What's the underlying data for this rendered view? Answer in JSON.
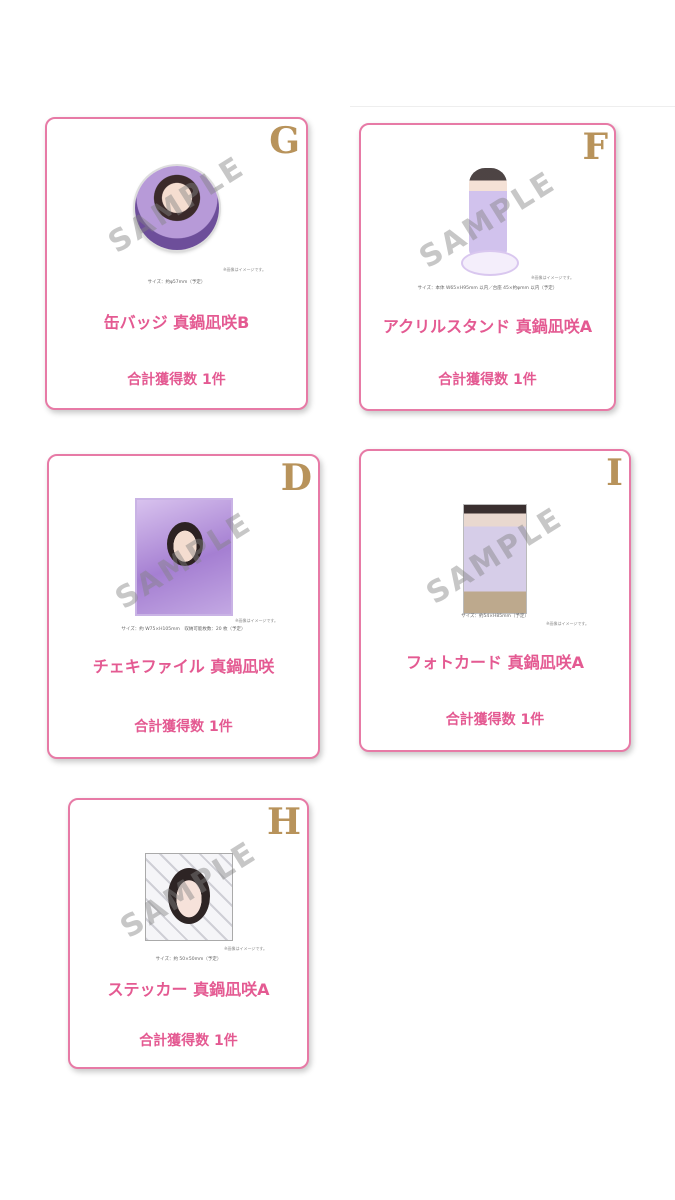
{
  "watermark": "SAMPLE",
  "image_note": "※画像はイメージです。",
  "prizes": [
    {
      "grade": "G",
      "title": "缶バッジ 真鍋凪咲B",
      "count": "合計獲得数 1件",
      "size": "サイズ：約φ57mm（予定）",
      "image": "can-badge"
    },
    {
      "grade": "F",
      "title": "アクリルスタンド 真鍋凪咲A",
      "count": "合計獲得数 1件",
      "size": "サイズ：本体 W65×H95mm 以内／台座 45×約φmm 以内（予定）",
      "image": "acrylic-stand"
    },
    {
      "grade": "D",
      "title": "チェキファイル 真鍋凪咲",
      "count": "合計獲得数 1件",
      "size": "サイズ：約 W75×H105mm　収納可能枚数：20 枚（予定）",
      "image": "cheki-file"
    },
    {
      "grade": "I",
      "title": "フォトカード 真鍋凪咲A",
      "count": "合計獲得数 1件",
      "size": "サイズ：約54×H85mm（予定）",
      "image": "photo-card"
    },
    {
      "grade": "H",
      "title": "ステッカー 真鍋凪咲A",
      "count": "合計獲得数 1件",
      "size": "サイズ：約 50×50mm（予定）",
      "image": "sticker"
    }
  ]
}
